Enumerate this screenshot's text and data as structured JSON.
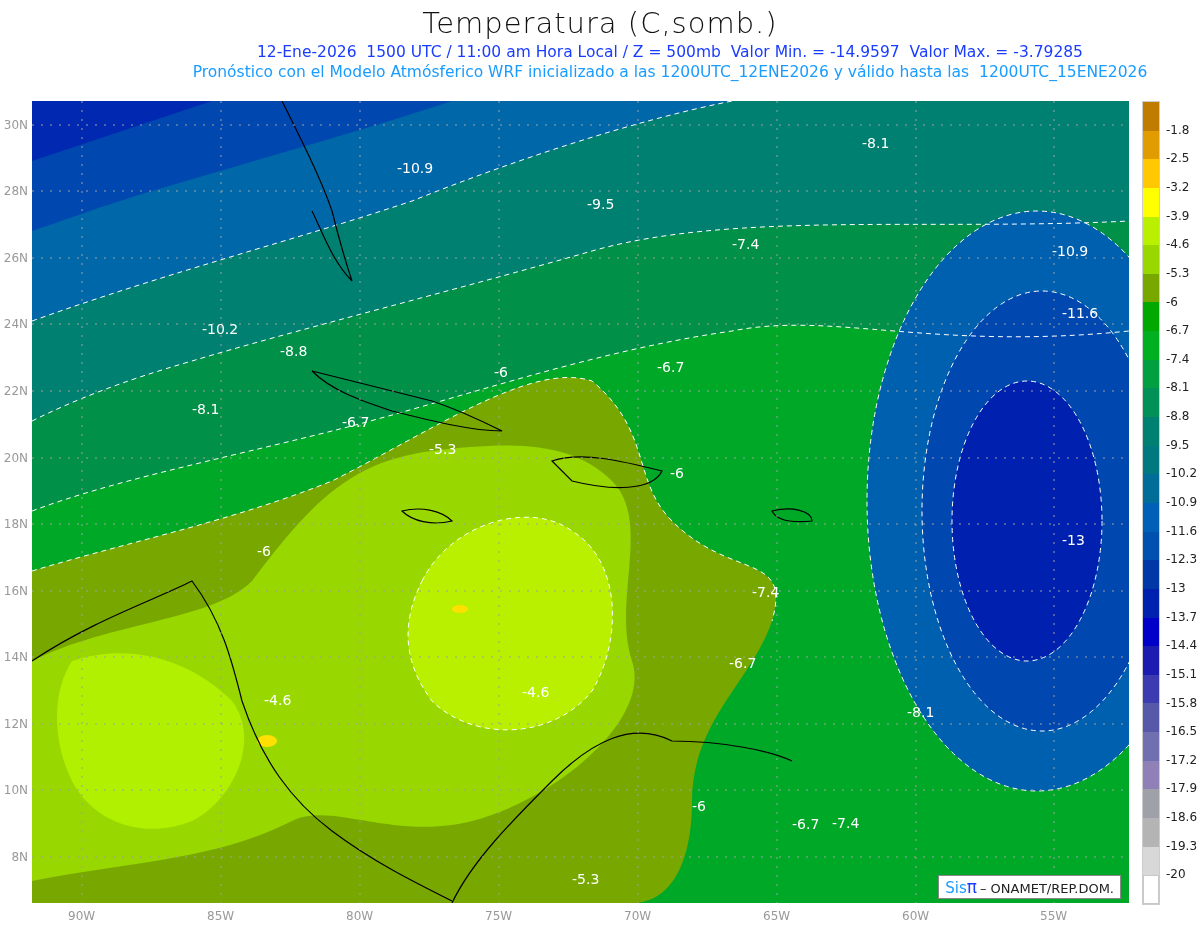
{
  "title": "Temperatura (C,somb.)",
  "subtitle_1": "12-Ene-2026  1500 UTC / 11:00 am Hora Local / Z = 500mb  Valor Min. = -14.9597  Valor Max. = -3.79285",
  "subtitle_2": "Pronóstico con el Modelo Atmósferico WRF inicializado a las 1200UTC_12ENE2026 y válido hasta las  1200UTC_15ENE2026",
  "latitude_labels": [
    "30N",
    "28N",
    "26N",
    "24N",
    "22N",
    "20N",
    "18N",
    "16N",
    "14N",
    "12N",
    "10N",
    "8N"
  ],
  "longitude_labels": [
    "90W",
    "85W",
    "80W",
    "75W",
    "70W",
    "65W",
    "60W",
    "55W"
  ],
  "contour_labels": [
    "-8.1",
    "-10.9",
    "-9.5",
    "-7.4",
    "-10.9",
    "-10.2",
    "-11.6",
    "-8.8",
    "-6",
    "-6.7",
    "-8.1",
    "-6.7",
    "-5.3",
    "-6",
    "-13",
    "-6",
    "-7.4",
    "-4.6",
    "-4.6",
    "-6.7",
    "-8.1",
    "-6",
    "-6.7",
    "-7.4",
    "-5.3"
  ],
  "credit": {
    "logo_text": "Sis",
    "logo_symbol": "π",
    "text": "– ONAMET/REP.DOM."
  },
  "colorbar": {
    "cells": [
      {
        "color": "#c07c00"
      },
      {
        "color": "#e09c00"
      },
      {
        "color": "#ffc800"
      },
      {
        "color": "#ffff00"
      },
      {
        "color": "#b8f000"
      },
      {
        "color": "#98d800"
      },
      {
        "color": "#78a800"
      },
      {
        "color": "#00a800"
      },
      {
        "color": "#00b020"
      },
      {
        "color": "#00a040"
      },
      {
        "color": "#009058"
      },
      {
        "color": "#008070"
      },
      {
        "color": "#007880"
      },
      {
        "color": "#006c98"
      },
      {
        "color": "#0060b8"
      },
      {
        "color": "#0050b0"
      },
      {
        "color": "#0038a8"
      },
      {
        "color": "#0020b0"
      },
      {
        "color": "#0000c8"
      },
      {
        "color": "#1c1cb0"
      },
      {
        "color": "#3c3cb0"
      },
      {
        "color": "#5858a8"
      },
      {
        "color": "#7070b0"
      },
      {
        "color": "#9080b8"
      },
      {
        "color": "#a0a0a8"
      },
      {
        "color": "#b4b4b4"
      },
      {
        "color": "#d8d8d8"
      },
      {
        "color": "#ffffff"
      }
    ],
    "labels": [
      "-1.8",
      "-2.5",
      "-3.2",
      "-3.9",
      "-4.6",
      "-5.3",
      "-6",
      "-6.7",
      "-7.4",
      "-8.1",
      "-8.8",
      "-9.5",
      "-10.2",
      "-10.9",
      "-11.6",
      "-12.3",
      "-13",
      "-13.7",
      "-14.4",
      "-15.1",
      "-15.8",
      "-16.5",
      "-17.2",
      "-17.9",
      "-18.6",
      "-19.3",
      "-20"
    ]
  }
}
